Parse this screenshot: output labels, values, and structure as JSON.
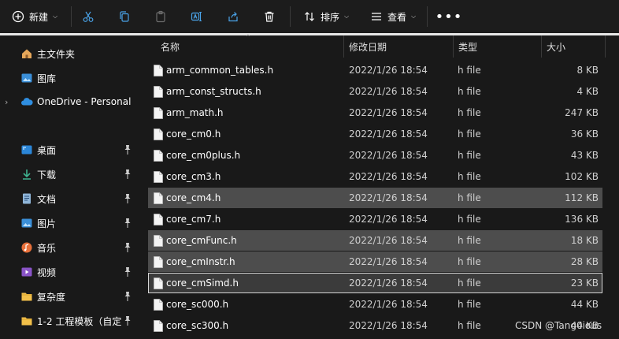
{
  "toolbar": {
    "new_label": "新建",
    "sort_label": "排序",
    "view_label": "查看",
    "more_label": "•••",
    "icons": [
      "new-plus-icon",
      "cut-icon",
      "copy-icon",
      "paste-icon",
      "rename-icon",
      "share-icon",
      "delete-icon",
      "sort-icon",
      "view-icon"
    ]
  },
  "sidebar": {
    "items": [
      {
        "label": "主文件夹",
        "icon": "home-icon",
        "pinned": false
      },
      {
        "label": "图库",
        "icon": "gallery-icon",
        "pinned": false
      },
      {
        "label": "OneDrive - Personal",
        "icon": "cloud-icon",
        "pinned": false
      },
      {
        "label": "桌面",
        "icon": "desktop-icon",
        "pinned": true
      },
      {
        "label": "下载",
        "icon": "download-icon",
        "pinned": true
      },
      {
        "label": "文档",
        "icon": "document-icon",
        "pinned": true
      },
      {
        "label": "图片",
        "icon": "pictures-icon",
        "pinned": true
      },
      {
        "label": "音乐",
        "icon": "music-icon",
        "pinned": true
      },
      {
        "label": "视频",
        "icon": "video-icon",
        "pinned": true
      },
      {
        "label": "复杂度",
        "icon": "folder-icon",
        "pinned": true
      },
      {
        "label": "1-2 工程模板（自定",
        "icon": "folder-icon",
        "pinned": true
      }
    ]
  },
  "table": {
    "columns": {
      "name": "名称",
      "date": "修改日期",
      "type": "类型",
      "size": "大小"
    },
    "rows": [
      {
        "name": "arm_common_tables.h",
        "date": "2022/1/26 18:54",
        "type": "h file",
        "size": "8 KB",
        "state": "normal"
      },
      {
        "name": "arm_const_structs.h",
        "date": "2022/1/26 18:54",
        "type": "h file",
        "size": "4 KB",
        "state": "normal"
      },
      {
        "name": "arm_math.h",
        "date": "2022/1/26 18:54",
        "type": "h file",
        "size": "247 KB",
        "state": "normal"
      },
      {
        "name": "core_cm0.h",
        "date": "2022/1/26 18:54",
        "type": "h file",
        "size": "36 KB",
        "state": "normal"
      },
      {
        "name": "core_cm0plus.h",
        "date": "2022/1/26 18:54",
        "type": "h file",
        "size": "43 KB",
        "state": "normal"
      },
      {
        "name": "core_cm3.h",
        "date": "2022/1/26 18:54",
        "type": "h file",
        "size": "102 KB",
        "state": "normal"
      },
      {
        "name": "core_cm4.h",
        "date": "2022/1/26 18:54",
        "type": "h file",
        "size": "112 KB",
        "state": "selected"
      },
      {
        "name": "core_cm7.h",
        "date": "2022/1/26 18:54",
        "type": "h file",
        "size": "136 KB",
        "state": "normal"
      },
      {
        "name": "core_cmFunc.h",
        "date": "2022/1/26 18:54",
        "type": "h file",
        "size": "18 KB",
        "state": "selected"
      },
      {
        "name": "core_cmInstr.h",
        "date": "2022/1/26 18:54",
        "type": "h file",
        "size": "28 KB",
        "state": "selected"
      },
      {
        "name": "core_cmSimd.h",
        "date": "2022/1/26 18:54",
        "type": "h file",
        "size": "23 KB",
        "state": "focused"
      },
      {
        "name": "core_sc000.h",
        "date": "2022/1/26 18:54",
        "type": "h file",
        "size": "44 KB",
        "state": "normal"
      },
      {
        "name": "core_sc300.h",
        "date": "2022/1/26 18:54",
        "type": "h file",
        "size": "44 KB",
        "state": "normal"
      }
    ]
  },
  "watermark": "CSDN @Tang0ious",
  "colors": {
    "background": "#191919",
    "selected_row": "#4d4d4d",
    "focused_border": "#d6d6d6",
    "accent_blue": "#4aa3e8"
  }
}
